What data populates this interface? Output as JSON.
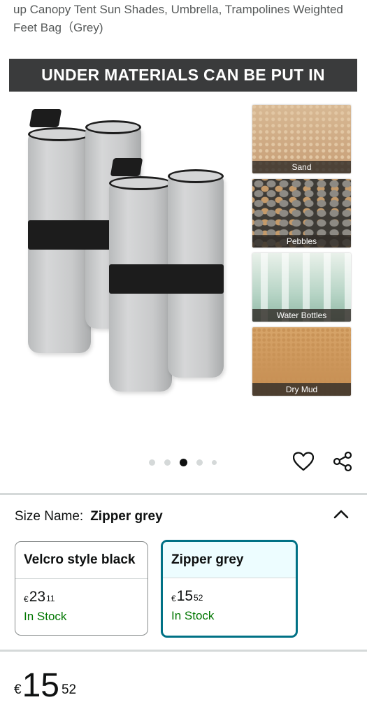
{
  "product": {
    "title_line1": "up Canopy Tent Sun Shades, Umbrella, Trampolines Weighted",
    "title_line2": "Feet Bag（Grey)"
  },
  "hero": {
    "banner_text": "UNDER MATERIALS CAN BE PUT IN",
    "thumbnails": [
      {
        "label": "Sand"
      },
      {
        "label": "Pebbles"
      },
      {
        "label": "Water Bottles"
      },
      {
        "label": "Dry Mud"
      }
    ],
    "carousel": {
      "total": 5,
      "active_index": 2
    }
  },
  "size_selector": {
    "label": "Size Name:",
    "selected_value": "Zipper grey",
    "options": [
      {
        "name": "Velcro style black",
        "currency": "€",
        "whole": "23",
        "fraction": "11",
        "stock": "In Stock",
        "selected": false
      },
      {
        "name": "Zipper grey",
        "currency": "€",
        "whole": "15",
        "fraction": "52",
        "stock": "In Stock",
        "selected": true
      }
    ]
  },
  "price": {
    "currency": "€",
    "whole": "15",
    "fraction": "52"
  },
  "colors": {
    "accent": "#007185",
    "stock_green": "#007600",
    "banner_bg": "#3a3b3c"
  },
  "icons": [
    "heart-icon",
    "share-icon",
    "chevron-up-icon"
  ]
}
